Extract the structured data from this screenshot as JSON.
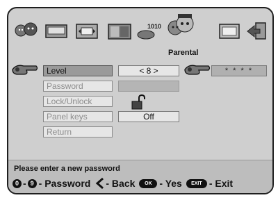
{
  "menu": {
    "tab_active_label": "Parental",
    "tabs": [
      {
        "name": "language-icon"
      },
      {
        "name": "tv-screen-icon"
      },
      {
        "name": "picture-format-icon"
      },
      {
        "name": "channel-list-icon"
      },
      {
        "name": "binary-data-icon"
      },
      {
        "name": "parental-family-icon"
      },
      {
        "name": "window-icon"
      },
      {
        "name": "exit-door-icon"
      }
    ],
    "items": [
      {
        "label": "Level",
        "value": "< 8 >"
      },
      {
        "label": "Password",
        "value": ""
      },
      {
        "label": "Lock/Unlock",
        "value": ""
      },
      {
        "label": "Panel keys",
        "value": "Off"
      },
      {
        "label": "Return",
        "value": ""
      }
    ],
    "password_mask": "* * * *"
  },
  "footer": {
    "message": "Please enter a new password",
    "key_0": "0",
    "key_9": "9",
    "dash": "-",
    "password_label": "- Password",
    "back_label": "- Back",
    "ok_key": "OK",
    "yes_label": "- Yes",
    "exit_key": "EXIT",
    "exit_label": "- Exit"
  },
  "colors": {
    "panel_bg": "#cfcfcf",
    "selected_item_bg": "#9a9a9a",
    "item_bg": "#e6e6e6"
  }
}
